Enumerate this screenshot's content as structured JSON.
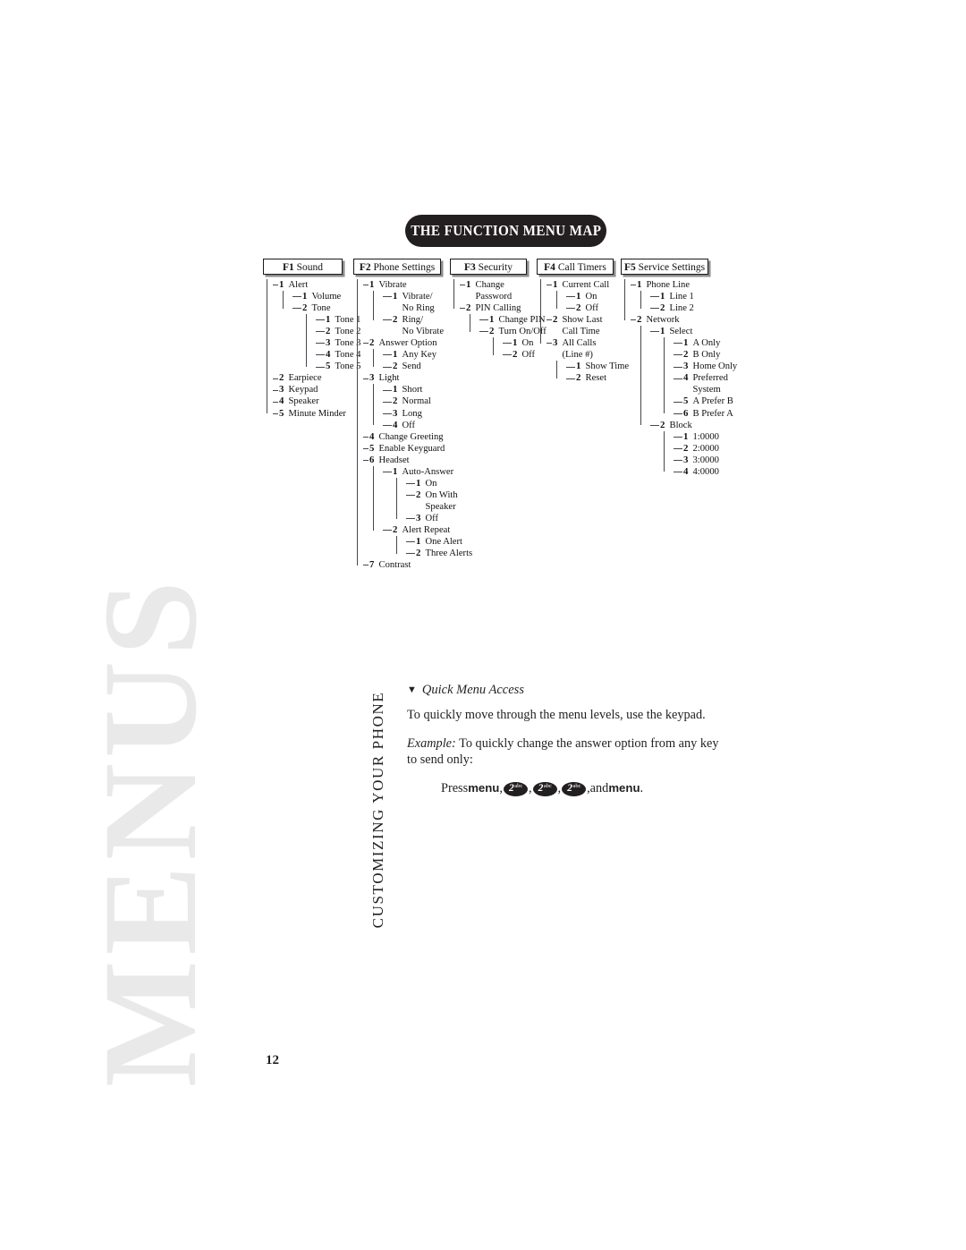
{
  "page": {
    "title": "THE FUNCTION MENU MAP",
    "page_number": "12",
    "watermark": "MENUS",
    "running_head": "CUSTOMIZING YOUR PHONE",
    "background_color": "#ffffff",
    "title_pill_color": "#231f20",
    "rule_color": "#4a4450"
  },
  "menu_map": {
    "columns": [
      {
        "key": "F1",
        "name": "Sound",
        "items": [
          {
            "num": "1",
            "label": "Alert",
            "children": [
              {
                "num": "1",
                "label": "Volume"
              },
              {
                "num": "2",
                "label": "Tone",
                "children": [
                  {
                    "num": "1",
                    "label": "Tone 1"
                  },
                  {
                    "num": "2",
                    "label": "Tone 2"
                  },
                  {
                    "num": "3",
                    "label": "Tone 3"
                  },
                  {
                    "num": "4",
                    "label": "Tone 4"
                  },
                  {
                    "num": "5",
                    "label": "Tone 5"
                  }
                ]
              }
            ]
          },
          {
            "num": "2",
            "label": "Earpiece"
          },
          {
            "num": "3",
            "label": "Keypad"
          },
          {
            "num": "4",
            "label": "Speaker"
          },
          {
            "num": "5",
            "label": "Minute Minder"
          }
        ]
      },
      {
        "key": "F2",
        "name": "Phone Settings",
        "items": [
          {
            "num": "1",
            "label": "Vibrate",
            "children": [
              {
                "num": "1",
                "label": "Vibrate/",
                "label2": "No Ring"
              },
              {
                "num": "2",
                "label": "Ring/",
                "label2": "No Vibrate"
              }
            ]
          },
          {
            "num": "2",
            "label": "Answer Option",
            "children": [
              {
                "num": "1",
                "label": "Any Key"
              },
              {
                "num": "2",
                "label": "Send"
              }
            ]
          },
          {
            "num": "3",
            "label": "Light",
            "children": [
              {
                "num": "1",
                "label": "Short"
              },
              {
                "num": "2",
                "label": "Normal"
              },
              {
                "num": "3",
                "label": "Long"
              },
              {
                "num": "4",
                "label": "Off"
              }
            ]
          },
          {
            "num": "4",
            "label": "Change Greeting"
          },
          {
            "num": "5",
            "label": "Enable Keyguard"
          },
          {
            "num": "6",
            "label": "Headset",
            "children": [
              {
                "num": "1",
                "label": "Auto-Answer",
                "children": [
                  {
                    "num": "1",
                    "label": "On"
                  },
                  {
                    "num": "2",
                    "label": "On With",
                    "label2": "Speaker"
                  },
                  {
                    "num": "3",
                    "label": "Off"
                  }
                ]
              },
              {
                "num": "2",
                "label": "Alert Repeat",
                "children": [
                  {
                    "num": "1",
                    "label": "One Alert"
                  },
                  {
                    "num": "2",
                    "label": "Three Alerts"
                  }
                ]
              }
            ]
          },
          {
            "num": "7",
            "label": "Contrast"
          }
        ]
      },
      {
        "key": "F3",
        "name": "Security",
        "items": [
          {
            "num": "1",
            "label": "Change",
            "label2": "Password"
          },
          {
            "num": "2",
            "label": "PIN Calling",
            "children": [
              {
                "num": "1",
                "label": "Change PIN"
              },
              {
                "num": "2",
                "label": "Turn On/Off",
                "children": [
                  {
                    "num": "1",
                    "label": "On"
                  },
                  {
                    "num": "2",
                    "label": "Off"
                  }
                ]
              }
            ]
          }
        ]
      },
      {
        "key": "F4",
        "name": "Call Timers",
        "items": [
          {
            "num": "1",
            "label": "Current Call",
            "children": [
              {
                "num": "1",
                "label": "On"
              },
              {
                "num": "2",
                "label": "Off"
              }
            ]
          },
          {
            "num": "2",
            "label": "Show Last",
            "label2": "Call Time"
          },
          {
            "num": "3",
            "label": "All Calls",
            "label2": "(Line #)",
            "children": [
              {
                "num": "1",
                "label": "Show Time"
              },
              {
                "num": "2",
                "label": "Reset"
              }
            ]
          }
        ]
      },
      {
        "key": "F5",
        "name": "Service Settings",
        "items": [
          {
            "num": "1",
            "label": "Phone Line",
            "children": [
              {
                "num": "1",
                "label": "Line 1"
              },
              {
                "num": "2",
                "label": "Line 2"
              }
            ]
          },
          {
            "num": "2",
            "label": "Network",
            "children": [
              {
                "num": "1",
                "label": "Select",
                "children": [
                  {
                    "num": "1",
                    "label": "A Only"
                  },
                  {
                    "num": "2",
                    "label": "B Only"
                  },
                  {
                    "num": "3",
                    "label": "Home Only"
                  },
                  {
                    "num": "4",
                    "label": "Preferred",
                    "label2": "System"
                  },
                  {
                    "num": "5",
                    "label": "A Prefer B"
                  },
                  {
                    "num": "6",
                    "label": "B Prefer A"
                  }
                ]
              },
              {
                "num": "2",
                "label": "Block",
                "children": [
                  {
                    "num": "1",
                    "label": "1:0000"
                  },
                  {
                    "num": "2",
                    "label": "2:0000"
                  },
                  {
                    "num": "3",
                    "label": "3:0000"
                  },
                  {
                    "num": "4",
                    "label": "4:0000"
                  }
                ]
              }
            ]
          }
        ]
      }
    ]
  },
  "quick_access": {
    "bullet": "▼",
    "heading": "Quick Menu Access",
    "paragraph": "To quickly move through the menu levels, use the keypad.",
    "example_label": "Example:",
    "example_text": " To quickly change the answer option from any key to send only:",
    "press_prefix": "Press",
    "menu_key_label": "menu",
    "keys": [
      {
        "digit": "2",
        "letters": "abc"
      },
      {
        "digit": "2",
        "letters": "abc"
      },
      {
        "digit": "2",
        "letters": "abc"
      }
    ],
    "and_word": "and",
    "trailing_period": "."
  }
}
